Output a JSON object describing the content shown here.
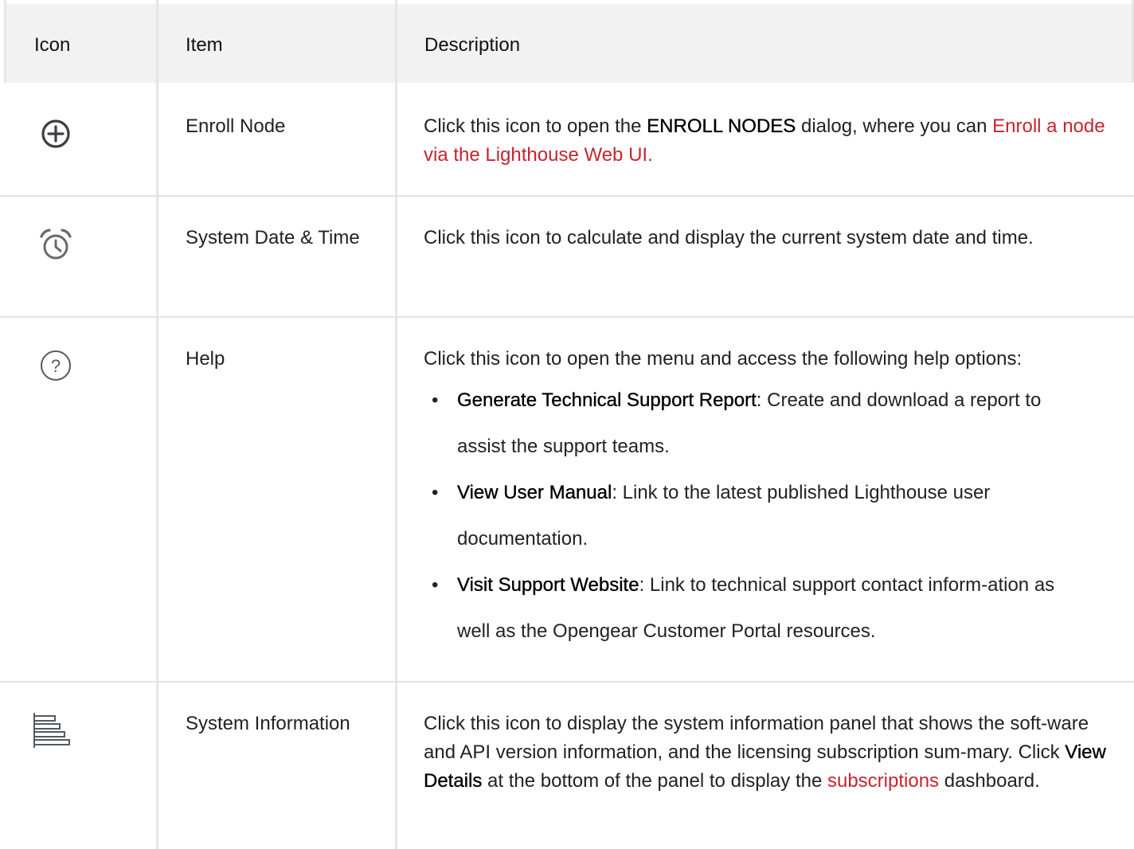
{
  "header": {
    "icon": "Icon",
    "item": "Item",
    "description": "Description"
  },
  "rows": [
    {
      "icon": "plus-circle-icon",
      "item": "Enroll Node",
      "desc_before": "Click this icon to open the ",
      "desc_bold": "ENROLL NODES",
      "desc_after": " dialog, where you can ",
      "desc_link": "Enroll a node via the Lighthouse Web UI."
    },
    {
      "icon": "alarm-clock-icon",
      "item": "System Date & Time",
      "desc": "Click this icon to calculate and display the current system date and time."
    },
    {
      "icon": "help-circle-icon",
      "item": "Help",
      "desc": "Click this icon to open the menu and access the following help options:",
      "options": [
        {
          "title": "Generate Technical Support Report",
          "text": ": Create and download a report to assist the support teams."
        },
        {
          "title": "View User Manual",
          "text": ": Link to the latest published Lighthouse user documentation."
        },
        {
          "title": "Visit Support Website",
          "text": ": Link to technical support contact inform-ation as well as the Opengear Customer Portal resources."
        }
      ]
    },
    {
      "icon": "system-info-icon",
      "item": "System Information",
      "desc_before": "Click this icon to display the system information panel that shows the soft-ware and API version information, and the licensing subscription sum-mary. Click ",
      "desc_bold": "View Details",
      "desc_after": " at the bottom of the panel to display the ",
      "desc_link": "subscriptions",
      "desc_end": " dashboard."
    }
  ]
}
